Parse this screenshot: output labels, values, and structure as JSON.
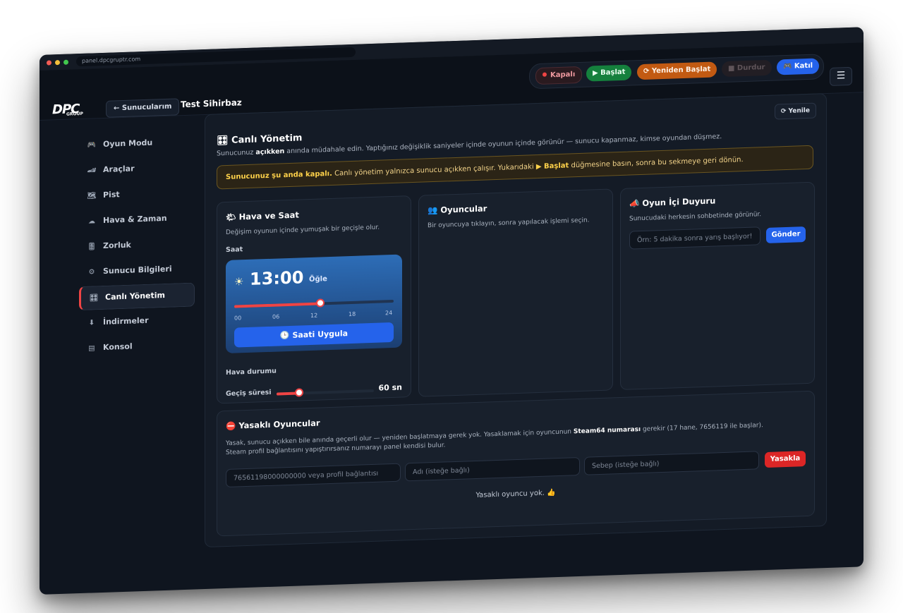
{
  "browser": {
    "url": "panel.dpcgruptr.com"
  },
  "header": {
    "logo_main": "DPC",
    "logo_sub": "GROUP",
    "back_label": "← Sunucularım",
    "server_name": "Test Sihirbaz",
    "status_label": "Kapalı",
    "start_label": "▶ Başlat",
    "restart_label": "⟳ Yeniden Başlat",
    "stop_label": "■ Durdur",
    "join_label": "🎮 Katıl",
    "menu_icon": "☰"
  },
  "sidebar": {
    "items": [
      {
        "icon": "🎮",
        "label": "Oyun Modu"
      },
      {
        "icon": "🏎",
        "label": "Araçlar"
      },
      {
        "icon": "🗺",
        "label": "Pist"
      },
      {
        "icon": "☁",
        "label": "Hava & Zaman"
      },
      {
        "icon": "🎚",
        "label": "Zorluk"
      },
      {
        "icon": "⚙",
        "label": "Sunucu Bilgileri"
      },
      {
        "icon": "🎛",
        "label": "Canlı Yönetim"
      },
      {
        "icon": "⬇",
        "label": "İndirmeler"
      },
      {
        "icon": "▤",
        "label": "Konsol"
      }
    ],
    "active_index": 6
  },
  "main": {
    "refresh_label": "⟳ Yenile",
    "title": "🎛 Canlı Yönetim",
    "subtitle_pre": "Sunucunuz ",
    "subtitle_bold": "açıkken",
    "subtitle_post": " anında müdahale edin. Yaptığınız değişiklik saniyeler içinde oyunun içinde görünür — sunucu kapanmaz, kimse oyundan düşmez.",
    "warning_bold": "Sunucunuz şu anda kapalı.",
    "warning_mid": " Canlı yönetim yalnızca sunucu açıkken çalışır. Yukarıdaki ",
    "warning_btn": "▶ Başlat",
    "warning_post": " düğmesine basın, sonra bu sekmeye geri dönün.",
    "weather": {
      "title": "🌤 Hava ve Saat",
      "subtitle": "Değişim oyunun içinde yumuşak bir geçişle olur.",
      "time_label": "Saat",
      "time_value": "13:00",
      "day_part": "Öğle",
      "sun_icon": "☀",
      "time_fraction": 0.5417,
      "ticks": [
        "00",
        "06",
        "12",
        "18",
        "24"
      ],
      "apply_label": "🕒 Saati Uygula",
      "weather_label": "Hava durumu",
      "transition_label": "Geçiş süresi",
      "transition_value": "60 sn",
      "transition_fraction": 0.23
    },
    "players": {
      "title": "👥 Oyuncular",
      "subtitle": "Bir oyuncuya tıklayın, sonra yapılacak işlemi seçin."
    },
    "announce": {
      "title": "📣 Oyun İçi Duyuru",
      "subtitle": "Sunucudaki herkesin sohbetinde görünür.",
      "placeholder": "Örn: 5 dakika sonra yarış başlıyor!",
      "send_label": "Gönder"
    },
    "bans": {
      "title": "⛔ Yasaklı Oyuncular",
      "desc1_pre": "Yasak, sunucu açıkken bile anında geçerli olur — yeniden başlatmaya gerek yok. Yasaklamak için oyuncunun ",
      "desc1_bold": "Steam64 numarası",
      "desc1_post": " gerekir (17 hane, 7656119 ile başlar).",
      "desc2": "Steam profil bağlantısını yapıştırırsanız numarayı panel kendisi bulur.",
      "steam_placeholder": "76561198000000000 veya profil bağlantısı",
      "name_placeholder": "Adı (isteğe bağlı)",
      "reason_placeholder": "Sebep (isteğe bağlı)",
      "ban_label": "Yasakla",
      "empty_text": "Yasaklı oyuncu yok. 👍"
    }
  },
  "colors": {
    "accent": "#2563eb",
    "danger": "#ef4444",
    "warning": "#ffd24a"
  }
}
